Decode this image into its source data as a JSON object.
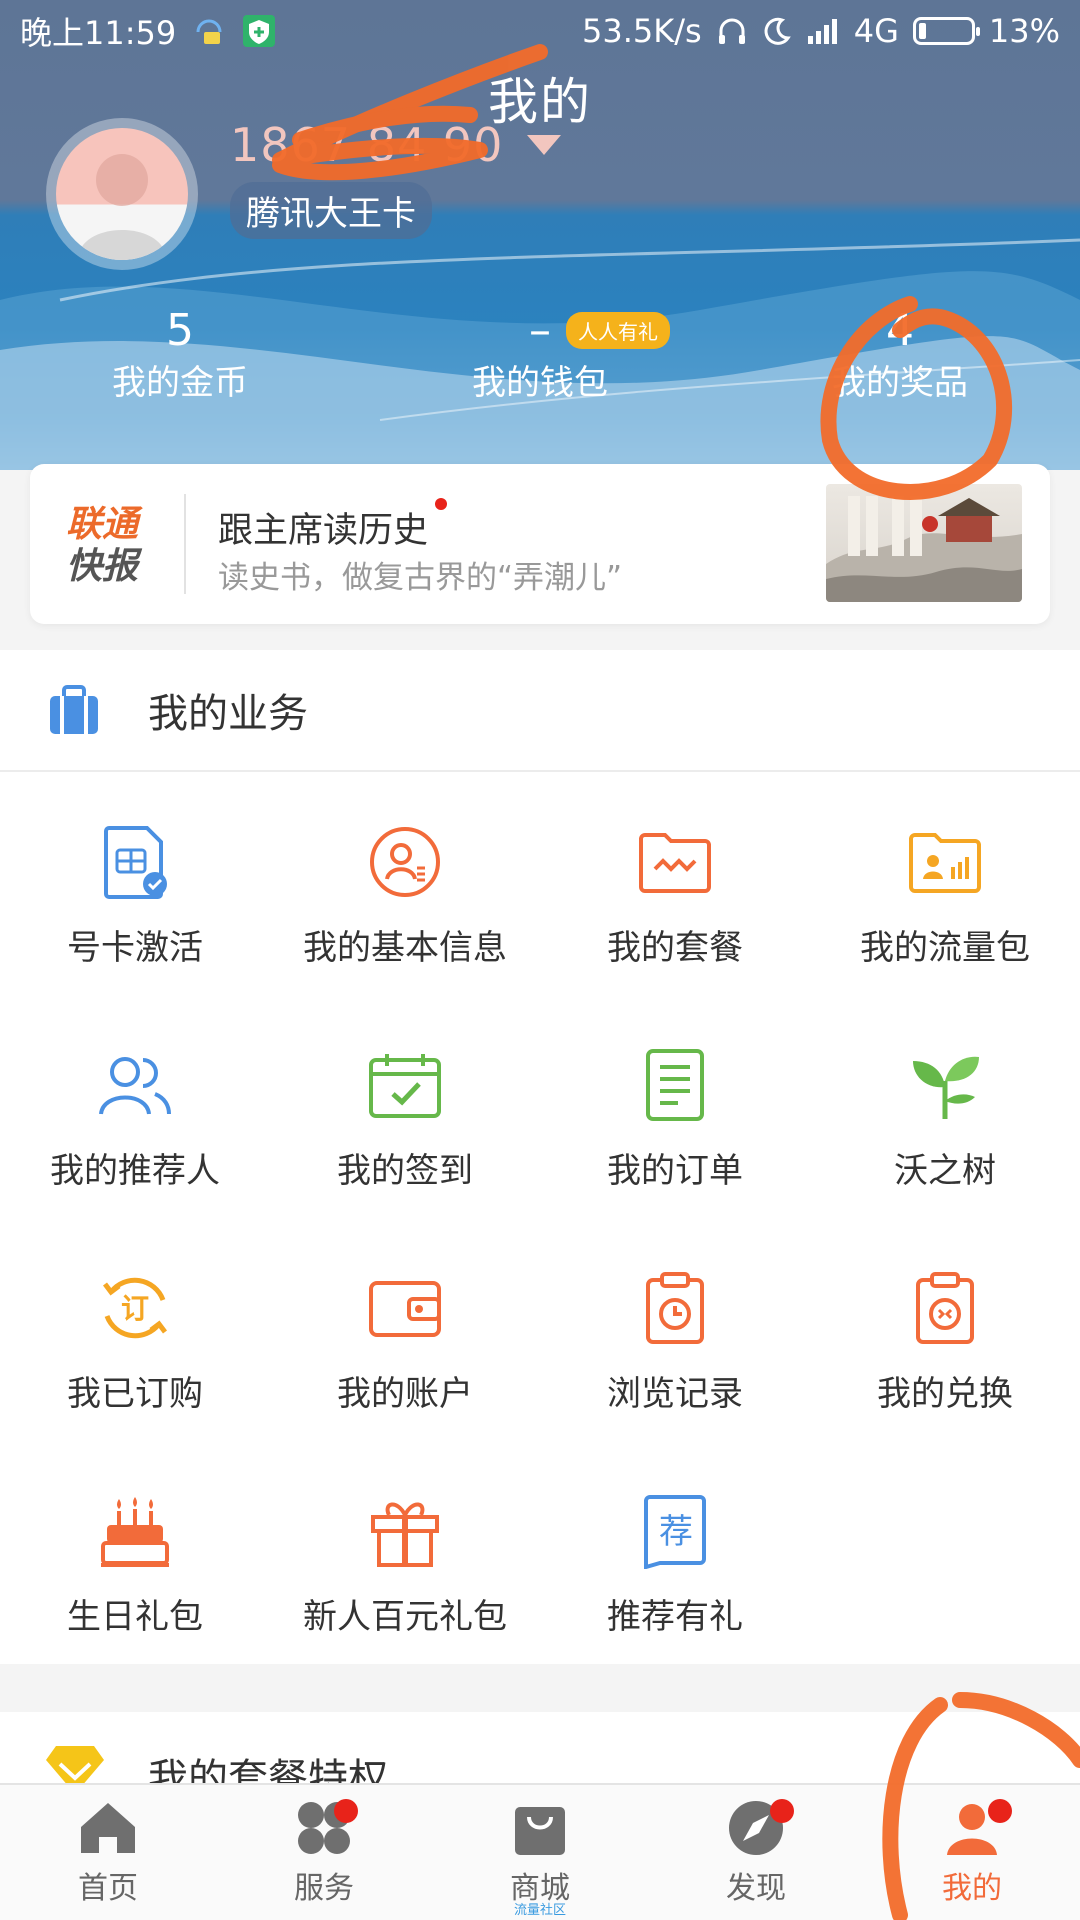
{
  "status_bar": {
    "time": "晚上11:59",
    "speed": "53.5K/s",
    "network": "4G",
    "battery": "13%",
    "battery_level": 0.13
  },
  "header": {
    "title": "我的",
    "phone_masked": "1867 84 90",
    "card_type": "腾讯大王卡",
    "stats": [
      {
        "value": "5",
        "label": "我的金币"
      },
      {
        "value": "–",
        "label": "我的钱包",
        "tag": "人人有礼"
      },
      {
        "value": "4",
        "label": "我的奖品"
      }
    ]
  },
  "news": {
    "logo_line1": "联通",
    "logo_line2": "快报",
    "title": "跟主席读历史",
    "subtitle": "读史书，做复古界的“弄潮儿”"
  },
  "business": {
    "title": "我的业务",
    "items": [
      {
        "label": "号卡激活",
        "icon": "sim-card-icon",
        "color": "#4a90e2"
      },
      {
        "label": "我的基本信息",
        "icon": "profile-icon",
        "color": "#f26b3a"
      },
      {
        "label": "我的套餐",
        "icon": "package-folder-icon",
        "color": "#f26b3a"
      },
      {
        "label": "我的流量包",
        "icon": "data-folder-icon",
        "color": "#f5a623"
      },
      {
        "label": "我的推荐人",
        "icon": "referrer-icon",
        "color": "#4a90e2"
      },
      {
        "label": "我的签到",
        "icon": "calendar-check-icon",
        "color": "#66b84a"
      },
      {
        "label": "我的订单",
        "icon": "order-list-icon",
        "color": "#66b84a"
      },
      {
        "label": "沃之树",
        "icon": "sprout-icon",
        "color": "#66b84a"
      },
      {
        "label": "我已订购",
        "icon": "subscribed-icon",
        "color": "#f5a623"
      },
      {
        "label": "我的账户",
        "icon": "wallet-icon",
        "color": "#f26b3a"
      },
      {
        "label": "浏览记录",
        "icon": "history-clipboard-icon",
        "color": "#f26b3a"
      },
      {
        "label": "我的兑换",
        "icon": "exchange-clipboard-icon",
        "color": "#f26b3a"
      },
      {
        "label": "生日礼包",
        "icon": "birthday-cake-icon",
        "color": "#f26b3a"
      },
      {
        "label": "新人百元礼包",
        "icon": "gift-icon",
        "color": "#f26b3a"
      },
      {
        "label": "推荐有礼",
        "icon": "recommend-icon",
        "color": "#4a90e2"
      }
    ]
  },
  "privileges": {
    "title": "我的套餐特权"
  },
  "tabbar": {
    "items": [
      {
        "label": "首页",
        "icon": "home-icon"
      },
      {
        "label": "服务",
        "icon": "service-grid-icon"
      },
      {
        "label": "商城",
        "icon": "shopping-bag-icon",
        "sub": "流量社区"
      },
      {
        "label": "发现",
        "icon": "compass-icon"
      },
      {
        "label": "我的",
        "icon": "user-icon"
      }
    ]
  },
  "colors": {
    "accent": "#f26b3a",
    "brand_blue": "#2b82bf",
    "badge_red": "#e8231a"
  }
}
